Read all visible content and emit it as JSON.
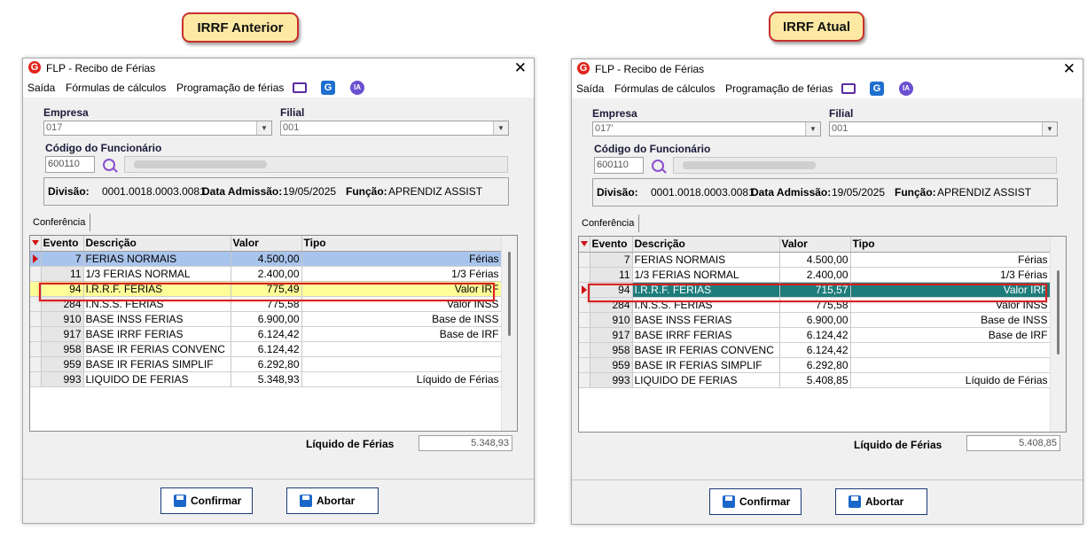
{
  "callouts": {
    "left": "IRRF Anterior",
    "right": "IRRF Atual"
  },
  "window": {
    "title": "FLP - Recibo de Férias",
    "close_glyph": "✕",
    "menu": [
      "Saída",
      "Fórmulas de cálculos",
      "Programação de férias"
    ],
    "toolbar_icons": [
      "monitor-icon",
      "g-icon",
      "ia-icon"
    ],
    "labels": {
      "empresa": "Empresa",
      "filial": "Filial",
      "codigo": "Código do Funcionário",
      "divisao": "Divisão:",
      "admissao": "Data Admissão:",
      "funcao": "Função:",
      "tab": "Conferência",
      "liquido": "Líquido de Férias",
      "confirmar": "Confirmar",
      "abortar": "Abortar"
    },
    "columns": [
      "Evento",
      "Descrição",
      "Valor",
      "Tipo"
    ],
    "info": {
      "divisao": "0001.0018.0003.0081",
      "admissao": "19/05/2025",
      "funcao": "APRENDIZ ASSIST"
    },
    "filial": "001",
    "codigo": "600110"
  },
  "left": {
    "empresa": "017",
    "rows": [
      {
        "evento": "7",
        "descricao": "FERIAS NORMAIS",
        "valor": "4.500,00",
        "tipo": "Férias"
      },
      {
        "evento": "11",
        "descricao": "1/3 FERIAS NORMAL",
        "valor": "2.400,00",
        "tipo": "1/3 Férias"
      },
      {
        "evento": "94",
        "descricao": "I.R.R.F. FERIAS",
        "valor": "775,49",
        "tipo": "Valor IRF"
      },
      {
        "evento": "284",
        "descricao": "I.N.S.S. FERIAS",
        "valor": "775,58",
        "tipo": "Valor INSS"
      },
      {
        "evento": "910",
        "descricao": "BASE INSS FERIAS",
        "valor": "6.900,00",
        "tipo": "Base de INSS"
      },
      {
        "evento": "917",
        "descricao": "BASE IRRF FERIAS",
        "valor": "6.124,42",
        "tipo": "Base de IRF"
      },
      {
        "evento": "958",
        "descricao": "BASE IR FERIAS CONVENC",
        "valor": "6.124,42",
        "tipo": ""
      },
      {
        "evento": "959",
        "descricao": "BASE IR FERIAS SIMPLIF",
        "valor": "6.292,80",
        "tipo": ""
      },
      {
        "evento": "993",
        "descricao": "LIQUIDO DE FERIAS",
        "valor": "5.348,93",
        "tipo": "Líquido de Férias"
      }
    ],
    "liquido": "5.348,93"
  },
  "right": {
    "empresa": "017'",
    "rows": [
      {
        "evento": "7",
        "descricao": "FERIAS NORMAIS",
        "valor": "4.500,00",
        "tipo": "Férias"
      },
      {
        "evento": "11",
        "descricao": "1/3 FERIAS NORMAL",
        "valor": "2.400,00",
        "tipo": "1/3 Férias"
      },
      {
        "evento": "94",
        "descricao": "I.R.R.F. FERIAS",
        "valor": "715,57",
        "tipo": "Valor IRF"
      },
      {
        "evento": "284",
        "descricao": "I.N.S.S. FERIAS",
        "valor": "775,58",
        "tipo": "Valor INSS"
      },
      {
        "evento": "910",
        "descricao": "BASE INSS FERIAS",
        "valor": "6.900,00",
        "tipo": "Base de INSS"
      },
      {
        "evento": "917",
        "descricao": "BASE IRRF FERIAS",
        "valor": "6.124,42",
        "tipo": "Base de IRF"
      },
      {
        "evento": "958",
        "descricao": "BASE IR FERIAS CONVENC",
        "valor": "6.124,42",
        "tipo": ""
      },
      {
        "evento": "959",
        "descricao": "BASE IR FERIAS SIMPLIF",
        "valor": "6.292,80",
        "tipo": ""
      },
      {
        "evento": "993",
        "descricao": "LIQUIDO DE FERIAS",
        "valor": "5.408,85",
        "tipo": "Líquido de Férias"
      }
    ],
    "liquido": "5.408,85"
  },
  "colors": {
    "highlight": "#ffff99",
    "selected": "#1e7c7a",
    "current_row": "#a9c4ec",
    "callout_border": "#c9302c"
  }
}
